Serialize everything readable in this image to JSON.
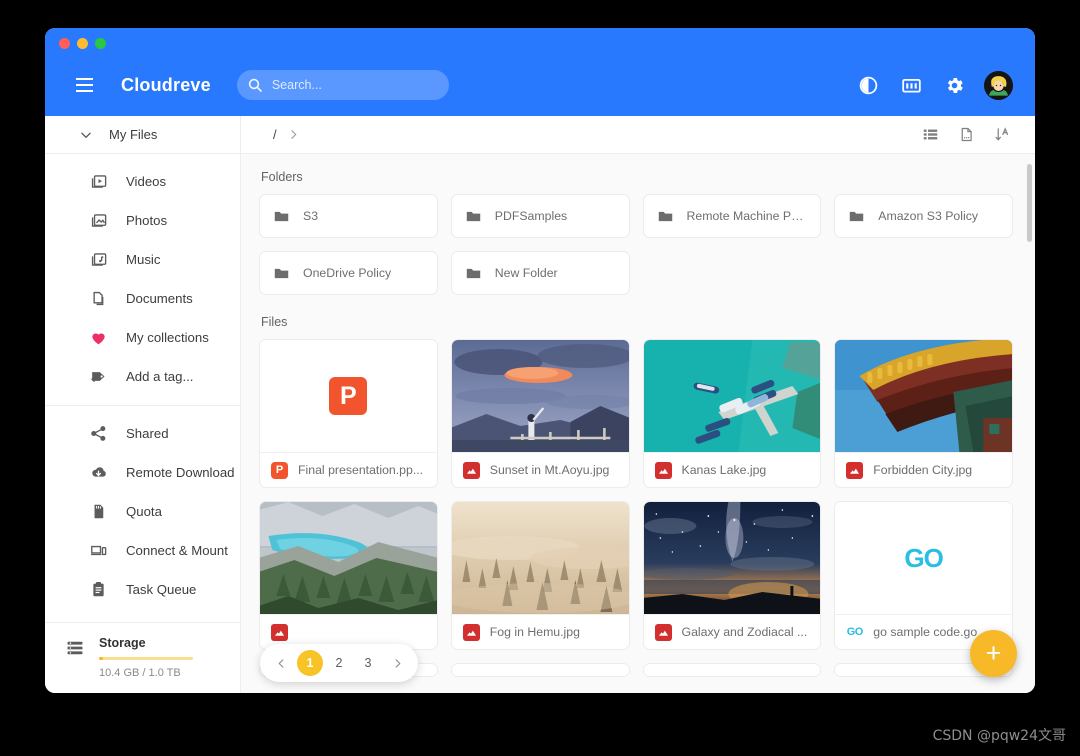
{
  "window": {
    "traffic_lights": [
      "close",
      "minimize",
      "maximize"
    ]
  },
  "appbar": {
    "brand": "Cloudreve",
    "menu_icon": "hamburger-icon",
    "search": {
      "value": "",
      "placeholder": "Search..."
    },
    "actions": [
      {
        "name": "dark-mode-toggle",
        "icon": "brightness-icon"
      },
      {
        "name": "dashboard-button",
        "icon": "dashboard-icon"
      },
      {
        "name": "settings-button",
        "icon": "gear-icon"
      },
      {
        "name": "user-avatar",
        "icon": "avatar"
      }
    ]
  },
  "sidebar": {
    "header": {
      "label": "My Files",
      "icon": "chevron-down-icon"
    },
    "items": [
      {
        "label": "Videos",
        "icon": "video-library-icon"
      },
      {
        "label": "Photos",
        "icon": "photo-library-icon"
      },
      {
        "label": "Music",
        "icon": "music-library-icon"
      },
      {
        "label": "Documents",
        "icon": "documents-icon"
      },
      {
        "label": "My collections",
        "icon": "heart-icon"
      },
      {
        "label": "Add a tag...",
        "icon": "add-tag-icon"
      }
    ],
    "items2": [
      {
        "label": "Shared",
        "icon": "share-icon"
      },
      {
        "label": "Remote Download",
        "icon": "cloud-download-icon"
      },
      {
        "label": "Quota",
        "icon": "sd-card-icon"
      },
      {
        "label": "Connect & Mount",
        "icon": "devices-icon"
      },
      {
        "label": "Task Queue",
        "icon": "clipboard-icon"
      }
    ],
    "storage": {
      "icon": "storage-icon",
      "title": "Storage",
      "usage_text": "10.4 GB / 1.0 TB",
      "used_percent": 1,
      "bar_color": "#f7b731"
    }
  },
  "toolbar": {
    "breadcrumb": [
      "/"
    ],
    "breadcrumb_more_icon": "chevron-right-icon",
    "buttons": [
      {
        "name": "list-view-button",
        "icon": "list-view-icon"
      },
      {
        "name": "new-file-button",
        "icon": "new-file-icon"
      },
      {
        "name": "sort-button",
        "icon": "sort-alpha-icon"
      }
    ]
  },
  "content": {
    "folders_title": "Folders",
    "folders": [
      {
        "name": "S3",
        "icon": "folder-icon"
      },
      {
        "name": "PDFSamples",
        "icon": "folder-icon"
      },
      {
        "name": "Remote Machine Poli...",
        "icon": "folder-icon"
      },
      {
        "name": "Amazon S3 Policy",
        "icon": "folder-icon"
      },
      {
        "name": "OneDrive Policy",
        "icon": "folder-icon"
      },
      {
        "name": "New Folder",
        "icon": "folder-icon"
      }
    ],
    "files_title": "Files",
    "files": [
      {
        "name": "Final presentation.pp...",
        "type": "powerpoint",
        "icon": "powerpoint-icon",
        "thumb": "none",
        "accent": "#F2542D"
      },
      {
        "name": "Sunset in Mt.Aoyu.jpg",
        "type": "image",
        "icon": "image-icon",
        "thumb": "sunset",
        "accent": "#D32F2F"
      },
      {
        "name": "Kanas Lake.jpg",
        "type": "image",
        "icon": "image-icon",
        "thumb": "harbor",
        "accent": "#D32F2F"
      },
      {
        "name": "Forbidden City.jpg",
        "type": "image",
        "icon": "image-icon",
        "thumb": "temple",
        "accent": "#D32F2F"
      },
      {
        "name": "",
        "type": "image",
        "icon": "image-icon",
        "thumb": "lake",
        "accent": "#D32F2F"
      },
      {
        "name": "Fog in Hemu.jpg",
        "type": "image",
        "icon": "image-icon",
        "thumb": "fog",
        "accent": "#D32F2F"
      },
      {
        "name": "Galaxy and Zodiacal ...",
        "type": "image",
        "icon": "image-icon",
        "thumb": "galaxy",
        "accent": "#D32F2F"
      },
      {
        "name": "go sample code.go",
        "type": "go",
        "icon": "go-icon",
        "thumb": "go",
        "accent": "#29BEE4"
      }
    ],
    "go_logo_text": "GO"
  },
  "pagination": {
    "prev_icon": "chevron-left-icon",
    "next_icon": "chevron-right-icon",
    "pages": [
      "1",
      "2",
      "3"
    ],
    "current": "1"
  },
  "fab": {
    "label": "+",
    "name": "add-button",
    "color": "#F7B928"
  },
  "watermark": "CSDN @pqw24文哥",
  "theme": {
    "primary": "#2979FF",
    "accent_yellow": "#F7B928",
    "page_bg": "#fafafa"
  }
}
